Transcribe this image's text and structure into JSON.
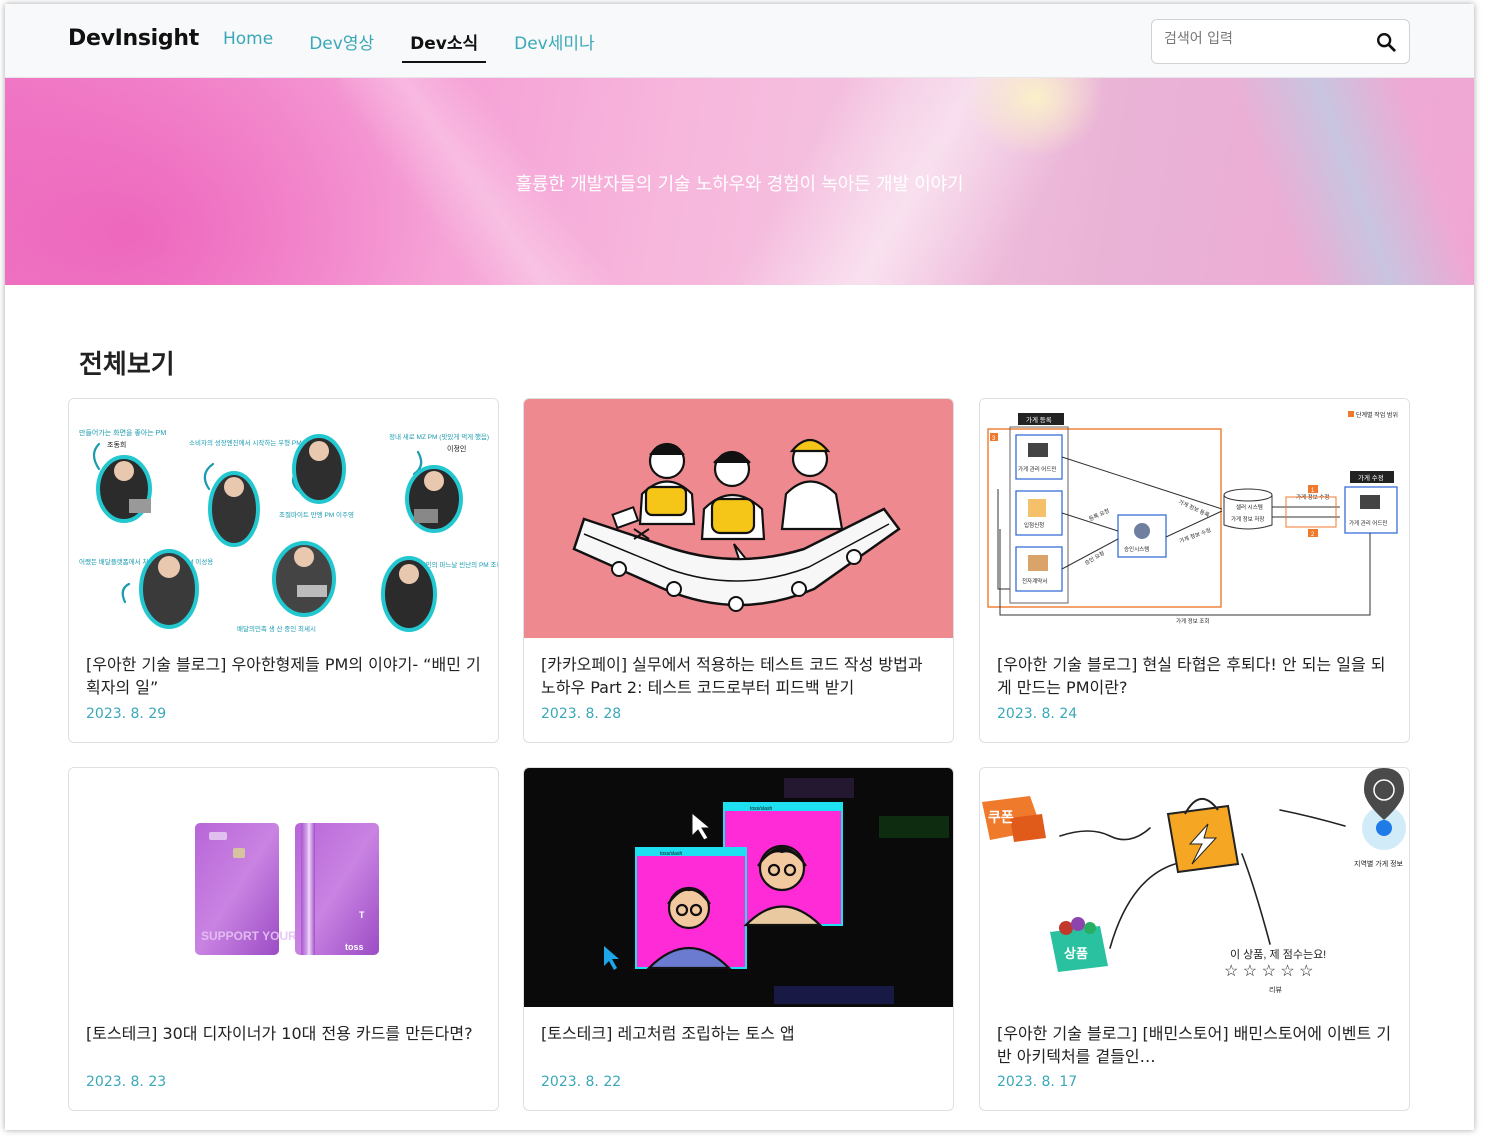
{
  "header": {
    "logo": "DevInsight",
    "nav": [
      {
        "label": "Home"
      },
      {
        "label": "Dev영상"
      },
      {
        "label": "Dev소식"
      },
      {
        "label": "Dev세미나"
      }
    ],
    "active_nav": "Dev소식",
    "search_placeholder": "검색어 입력"
  },
  "hero": {
    "tagline": "훌륭한 개발자들의 기술 노하우와 경험이 녹아든 개발 이야기"
  },
  "section_title": "전체보기",
  "cards": [
    {
      "title": "[우아한 기술 블로그] 우아한형제들 PM의 이야기- “배민 기획자의 일”",
      "date": "2023. 8. 29"
    },
    {
      "title": "[카카오페이] 실무에서 적용하는 테스트 코드 작성 방법과 노하우 Part 2: 테스트 코드로부터 피드백 받기",
      "date": "2023. 8. 28"
    },
    {
      "title": "[우아한 기술 블로그] 현실 타협은 후퇴다! 안 되는 일을 되게 만드는 PM이란?",
      "date": "2023. 8. 24"
    },
    {
      "title": "[토스테크] 30대 디자이너가 10대 전용 카드를 만든다면?",
      "date": "2023. 8. 23"
    },
    {
      "title": "[토스테크] 레고처럼 조립하는 토스 앱",
      "date": "2023. 8. 22"
    },
    {
      "title": "[우아한 기술 블로그] [배민스토어] 배민스토어에 이벤트 기반 아키텍처를 곁들인…",
      "date": "2023. 8. 17"
    }
  ],
  "thumbs": {
    "card1_labels": [
      "만들어가는 화면을 좋아는 PM",
      "조동희",
      "소비자의 성장엔진에서 시작하는 우형 PM 이성준",
      "정내 새로 MZ PM (맛있게 먹게 했음)",
      "이정인",
      "조절마이트 만엥 PM 이주영",
      "어쨌든 배달플랫폼에서 처리 학습 중인 PM 이성용",
      "가세어오 시민의 마느날 빈난의 PM 조혜인",
      "배달의민족 생 산 중인 최세시"
    ],
    "card3_labels": [
      "가게 등록",
      "단계별 작업 범위",
      "가게 관리 어드민",
      "입점신청",
      "전자계약서",
      "승인시스템",
      "셀러 시스템",
      "가게 정보 저장",
      "가게 정보 조회",
      "가게 정보 수정",
      "가게 수정",
      "가게 정보 등록",
      "등록 요청",
      "승인 요청",
      "1",
      "2",
      "3"
    ],
    "card4_labels": [
      "SUPPORT YOUR YOUTH",
      "toss",
      "T"
    ],
    "card5_labels": [
      "toss/slash",
      "toss/slash"
    ],
    "card6_labels": [
      "쿠폰",
      "상품",
      "이 상품, 제 점수는요!",
      "리뷰",
      "지역별 가게 정보"
    ]
  }
}
